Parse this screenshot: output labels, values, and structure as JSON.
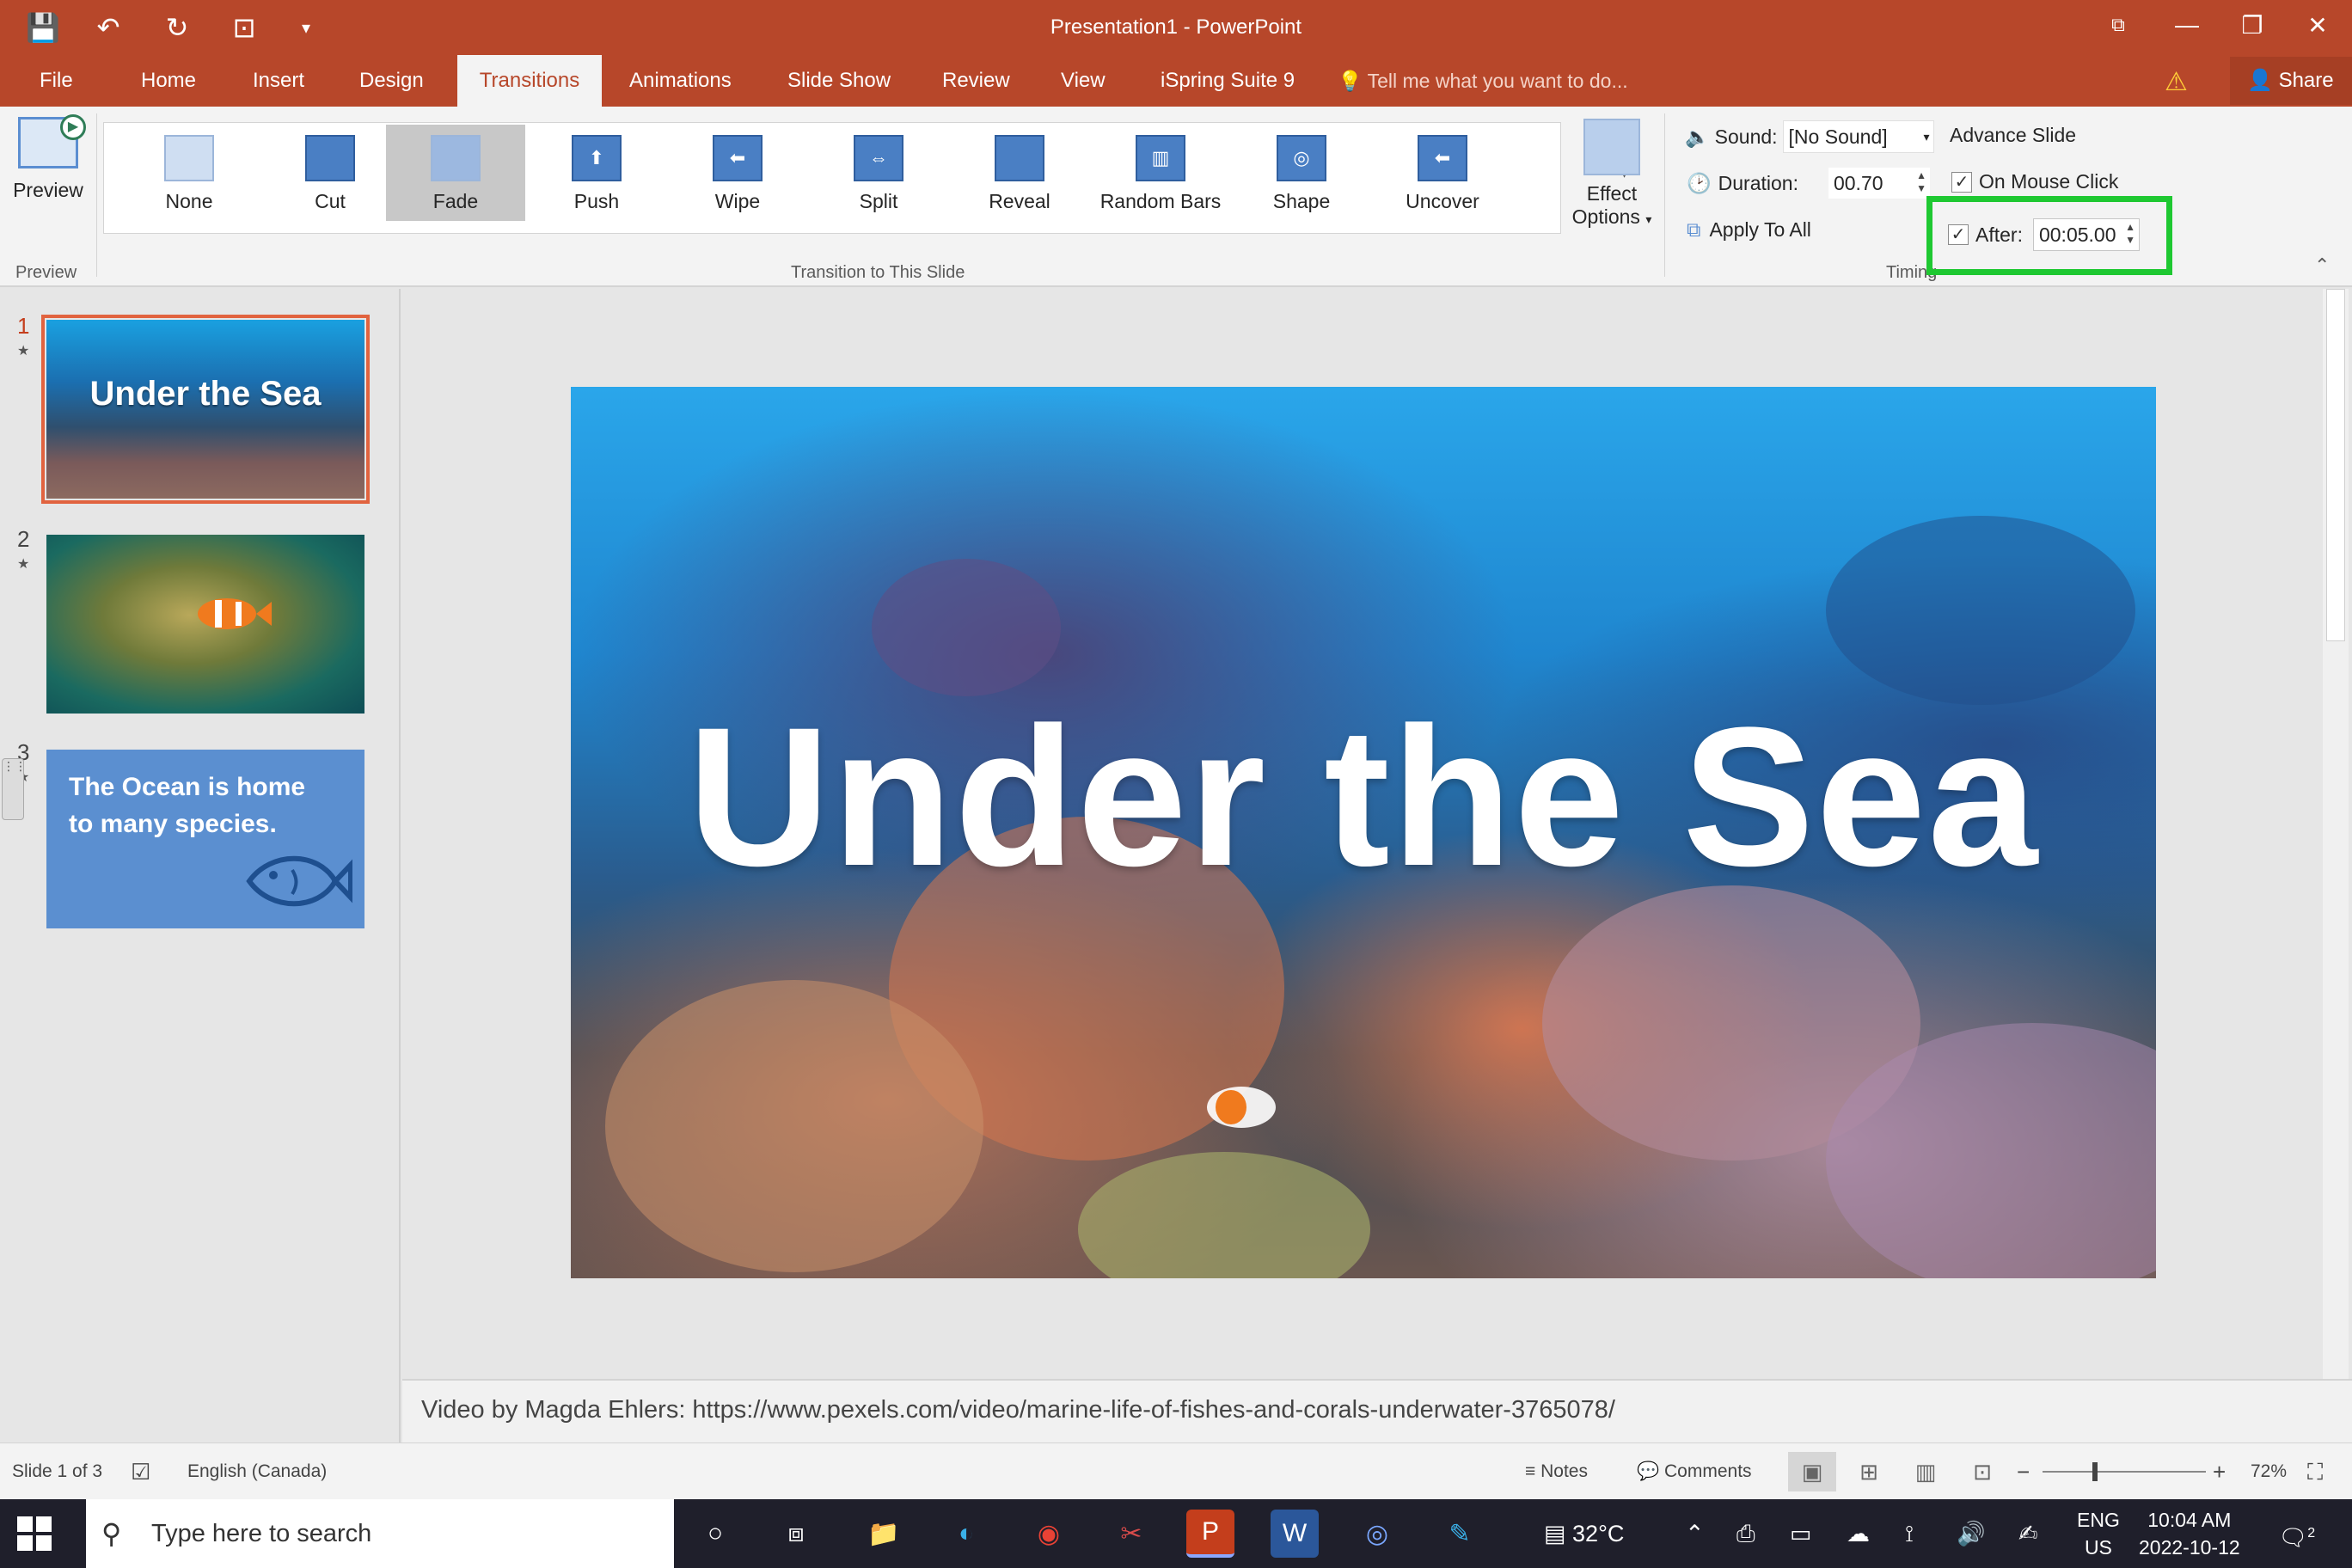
{
  "window": {
    "title": "Presentation1 - PowerPoint",
    "controls": {
      "restore_ribbon": "⧉",
      "minimize": "—",
      "maximize": "❐",
      "close": "✕"
    }
  },
  "quick_access": {
    "save": "💾",
    "undo": "↶",
    "redo": "↻",
    "present": "⊡",
    "customize": "▾"
  },
  "tabs": [
    "File",
    "Home",
    "Insert",
    "Design",
    "Transitions",
    "Animations",
    "Slide Show",
    "Review",
    "View",
    "iSpring Suite 9"
  ],
  "active_tab": "Transitions",
  "tell_me": "Tell me what you want to do...",
  "share_label": "Share",
  "ribbon": {
    "preview_label": "Preview",
    "preview_group_label": "Preview",
    "transitions": [
      {
        "label": "None",
        "glyph": ""
      },
      {
        "label": "Cut",
        "glyph": ""
      },
      {
        "label": "Fade",
        "glyph": ""
      },
      {
        "label": "Push",
        "glyph": "⬆"
      },
      {
        "label": "Wipe",
        "glyph": "⬅"
      },
      {
        "label": "Split",
        "glyph": "⇔"
      },
      {
        "label": "Reveal",
        "glyph": ""
      },
      {
        "label": "Random Bars",
        "glyph": "▥"
      },
      {
        "label": "Shape",
        "glyph": "◎"
      },
      {
        "label": "Uncover",
        "glyph": "⬅"
      }
    ],
    "selected_transition": "Fade",
    "gallery_group_label": "Transition to This Slide",
    "effect_options_line1": "Effect",
    "effect_options_line2": "Options",
    "timing": {
      "sound_label": "Sound:",
      "sound_value": "[No Sound]",
      "duration_label": "Duration:",
      "duration_value": "00.70",
      "apply_all_label": "Apply To All",
      "advance_label": "Advance Slide",
      "on_click_label": "On Mouse Click",
      "on_click_checked": true,
      "after_label": "After:",
      "after_value": "00:05.00",
      "after_checked": true,
      "group_label": "Timing"
    },
    "highlight_color": "#1ec831"
  },
  "slides": [
    {
      "number": "1",
      "title": "Under the Sea",
      "current": true
    },
    {
      "number": "2",
      "title": "",
      "current": false
    },
    {
      "number": "3",
      "text": "The Ocean is home to many species.",
      "current": false
    }
  ],
  "main_slide": {
    "title": "Under the Sea"
  },
  "notes_text": "Video by Magda Ehlers: https://www.pexels.com/video/marine-life-of-fishes-and-corals-underwater-3765078/",
  "status": {
    "slide_info": "Slide 1 of 3",
    "language": "English (Canada)",
    "notes_label": "Notes",
    "comments_label": "Comments",
    "zoom": "72%"
  },
  "taskbar": {
    "search_placeholder": "Type here to search",
    "weather": "32°C",
    "lang_line1": "ENG",
    "lang_line2": "US",
    "time": "10:04 AM",
    "date": "2022-10-12",
    "notifications": "2"
  },
  "colors": {
    "accent": "#b7472a",
    "selected_slide_border": "#e1633f"
  }
}
